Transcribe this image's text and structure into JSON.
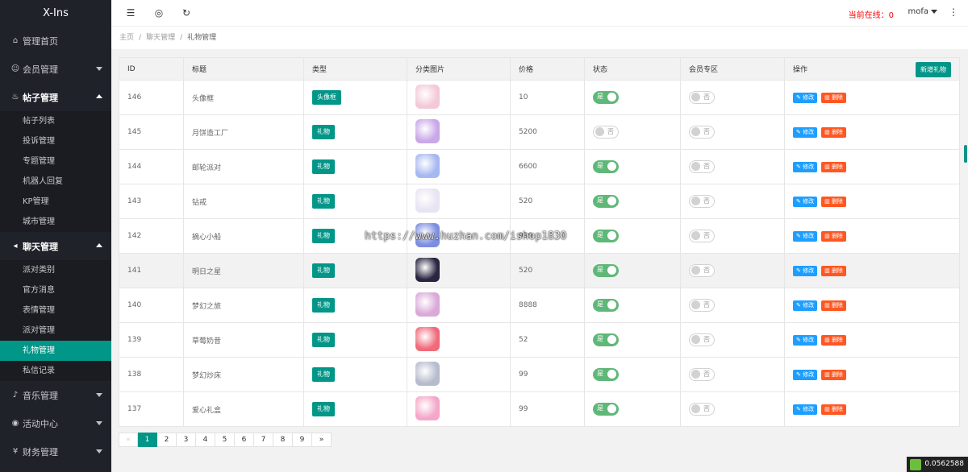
{
  "brand": "X-Ins",
  "sidebar": {
    "items": [
      {
        "label": "管理首页",
        "icon": "home-icon",
        "expanded": false
      },
      {
        "label": "会员管理",
        "icon": "user-icon",
        "expanded": false
      },
      {
        "label": "帖子管理",
        "icon": "fire-icon",
        "expanded": true,
        "children": [
          "帖子列表",
          "投诉管理",
          "专题管理",
          "机器人回复",
          "KP管理",
          "城市管理"
        ]
      },
      {
        "label": "聊天管理",
        "icon": "sound-icon",
        "expanded": true,
        "children": [
          "派对类别",
          "官方消息",
          "表情管理",
          "派对管理",
          "礼物管理",
          "私信记录"
        ]
      },
      {
        "label": "音乐管理",
        "icon": "music-icon",
        "expanded": false
      },
      {
        "label": "活动中心",
        "icon": "compass-icon",
        "expanded": false
      },
      {
        "label": "财务管理",
        "icon": "money-icon",
        "expanded": false
      }
    ],
    "active_sub": "礼物管理"
  },
  "header": {
    "online_label": "当前在线：0",
    "user": "mofa"
  },
  "breadcrumb": [
    "主页",
    "聊天管理",
    "礼物管理"
  ],
  "table": {
    "columns": [
      "ID",
      "标题",
      "类型",
      "分类图片",
      "价格",
      "状态",
      "会员专区",
      "操作"
    ],
    "add_button": "新增礼物",
    "edit_label": "修改",
    "delete_label": "删除",
    "switch_on": "是",
    "switch_off": "否",
    "rows": [
      {
        "id": "146",
        "title": "头像框",
        "type": "头像框",
        "price": "10",
        "status": true,
        "vip": false,
        "thumb_color": "#f3c9d8"
      },
      {
        "id": "145",
        "title": "月饼造工厂",
        "type": "礼物",
        "price": "5200",
        "status": false,
        "vip": false,
        "thumb_color": "#c9a8e8"
      },
      {
        "id": "144",
        "title": "邮轮派对",
        "type": "礼物",
        "price": "6600",
        "status": true,
        "vip": false,
        "thumb_color": "#a7b8f0"
      },
      {
        "id": "143",
        "title": "钻戒",
        "type": "礼物",
        "price": "520",
        "status": true,
        "vip": false,
        "thumb_color": "#e8e4f2"
      },
      {
        "id": "142",
        "title": "摘心小船",
        "type": "礼物",
        "price": "999",
        "status": true,
        "vip": false,
        "thumb_color": "#7d8ee0"
      },
      {
        "id": "141",
        "title": "明日之星",
        "type": "礼物",
        "price": "520",
        "status": true,
        "vip": false,
        "thumb_color": "#2a2540"
      },
      {
        "id": "140",
        "title": "梦幻之旅",
        "type": "礼物",
        "price": "8888",
        "status": true,
        "vip": false,
        "thumb_color": "#d9a9d8"
      },
      {
        "id": "139",
        "title": "草莓奶昔",
        "type": "礼物",
        "price": "52",
        "status": true,
        "vip": false,
        "thumb_color": "#f06a7a"
      },
      {
        "id": "138",
        "title": "梦幻炒床",
        "type": "礼物",
        "price": "99",
        "status": true,
        "vip": false,
        "thumb_color": "#b7bccd"
      },
      {
        "id": "137",
        "title": "爱心礼盒",
        "type": "礼物",
        "price": "99",
        "status": true,
        "vip": false,
        "thumb_color": "#f4a7c8"
      }
    ]
  },
  "pagination": {
    "prev": "«",
    "next": "»",
    "pages": [
      "1",
      "2",
      "3",
      "4",
      "5",
      "6",
      "7",
      "8",
      "9"
    ],
    "current": "1"
  },
  "timer": "0.0562588",
  "watermark": "https://www.huzhan.com/ishop1830"
}
